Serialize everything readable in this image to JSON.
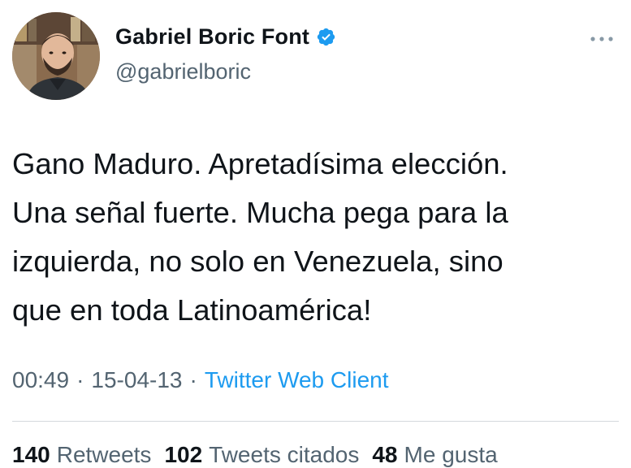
{
  "author": {
    "display_name": "Gabriel Boric Font",
    "handle": "@gabrielboric",
    "verified_icon": "verified-badge-icon",
    "avatar_icon": "profile-photo"
  },
  "tweet": {
    "text": "Gano Maduro. Apretadísima elección.\nUna señal fuerte. Mucha pega para la\nizquierda, no solo en Venezuela, sino\nque en toda Latinoamérica!"
  },
  "meta": {
    "time": "00:49",
    "separator": "·",
    "date": "15-04-13",
    "client": "Twitter Web Client"
  },
  "stats": {
    "retweets_count": "140",
    "retweets_label": "Retweets",
    "quotes_count": "102",
    "quotes_label": "Tweets citados",
    "likes_count": "48",
    "likes_label": "Me gusta"
  },
  "colors": {
    "accent": "#1d9bf0",
    "text": "#0f1419",
    "secondary": "#536471",
    "divider": "#d4d9dc"
  }
}
